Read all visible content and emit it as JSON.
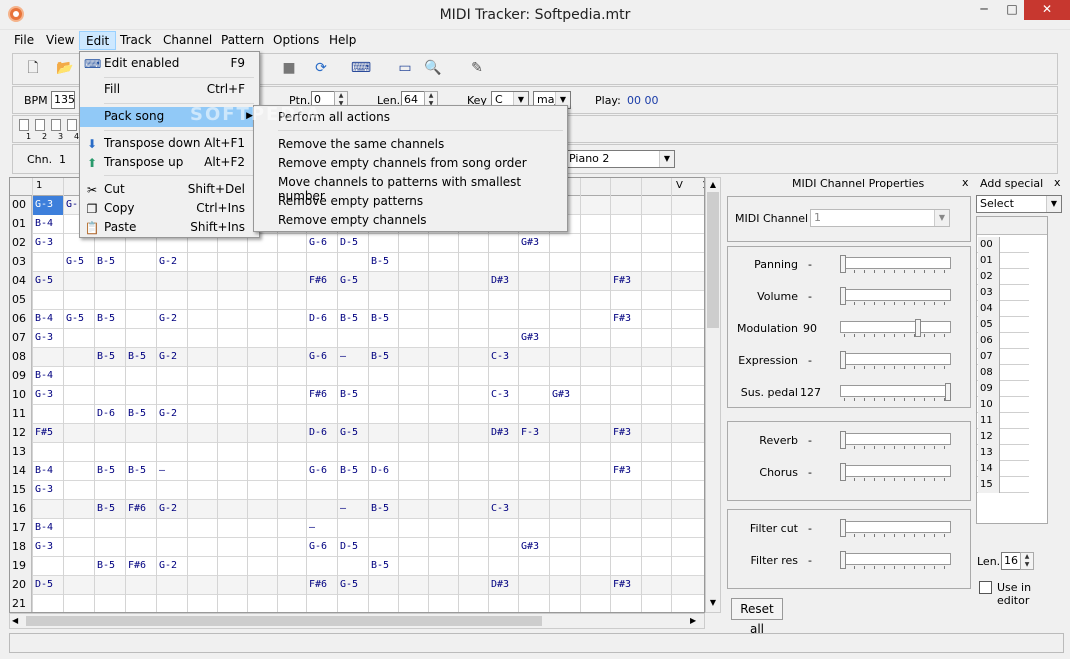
{
  "window": {
    "title": "MIDI Tracker: Softpedia.mtr",
    "min": "─",
    "max": "□",
    "close": "✕"
  },
  "menubar": [
    "File",
    "View",
    "Edit",
    "Track",
    "Channel",
    "Pattern",
    "Options",
    "Help"
  ],
  "toolbar": {
    "bpm_label": "BPM",
    "bpm_value": "135",
    "ptn_label": "Ptn.",
    "ptn_value": "0",
    "len_label": "Len.",
    "len_value": "64",
    "key_label": "Key",
    "key_value": "C",
    "scale_value": "maj",
    "play_label": "Play:",
    "play_value": "00 00"
  },
  "track_numbers": [
    "1",
    "2",
    "3",
    "4"
  ],
  "channel_row": {
    "label": "Chn.",
    "value": "1",
    "instrument": "Piano 2"
  },
  "grid": {
    "header_first": "1",
    "header_v": "V",
    "header_right": "1",
    "rows": [
      {
        "n": "00",
        "cells": [
          "G-3",
          "G-"
        ]
      },
      {
        "n": "01",
        "cells": [
          "B-4"
        ]
      },
      {
        "n": "02",
        "cells": [
          "G-3",
          "",
          "",
          "",
          "",
          "",
          "",
          "",
          "",
          "G-6",
          "D-5",
          "",
          "",
          "",
          "",
          "",
          "G#3"
        ]
      },
      {
        "n": "03",
        "cells": [
          "",
          "G-5",
          "B-5",
          "",
          "G-2",
          "",
          "",
          "",
          "",
          "",
          "",
          "B-5"
        ]
      },
      {
        "n": "04",
        "cells": [
          "G-5",
          "",
          "",
          "",
          "",
          "",
          "",
          "",
          "",
          "F#6",
          "G-5",
          "",
          "",
          "",
          "",
          "D#3",
          "",
          "",
          "",
          "F#3"
        ]
      },
      {
        "n": "05",
        "cells": []
      },
      {
        "n": "06",
        "cells": [
          "B-4",
          "G-5",
          "B-5",
          "",
          "G-2",
          "",
          "",
          "",
          "",
          "D-6",
          "B-5",
          "B-5",
          "",
          "",
          "",
          "",
          "",
          "",
          "",
          "F#3"
        ]
      },
      {
        "n": "07",
        "cells": [
          "G-3",
          "",
          "",
          "",
          "",
          "",
          "",
          "",
          "",
          "",
          "",
          "",
          "",
          "",
          "",
          "",
          "G#3"
        ]
      },
      {
        "n": "08",
        "cells": [
          "",
          "",
          "B-5",
          "B-5",
          "G-2",
          "",
          "",
          "",
          "",
          "G-6",
          "–",
          "B-5",
          "",
          "",
          "",
          "C-3"
        ]
      },
      {
        "n": "09",
        "cells": [
          "B-4"
        ]
      },
      {
        "n": "10",
        "cells": [
          "G-3",
          "",
          "",
          "",
          "",
          "",
          "",
          "",
          "",
          "F#6",
          "B-5",
          "",
          "",
          "",
          "",
          "C-3",
          "",
          "G#3"
        ]
      },
      {
        "n": "11",
        "cells": [
          "",
          "",
          "D-6",
          "B-5",
          "G-2"
        ]
      },
      {
        "n": "12",
        "cells": [
          "F#5",
          "",
          "",
          "",
          "",
          "",
          "",
          "",
          "",
          "D-6",
          "G-5",
          "",
          "",
          "",
          "",
          "D#3",
          "F-3",
          "",
          "",
          "F#3"
        ]
      },
      {
        "n": "13",
        "cells": []
      },
      {
        "n": "14",
        "cells": [
          "B-4",
          "",
          "B-5",
          "B-5",
          "–",
          "",
          "",
          "",
          "",
          "G-6",
          "B-5",
          "D-6",
          "",
          "",
          "",
          "",
          "",
          "",
          "",
          "F#3"
        ]
      },
      {
        "n": "15",
        "cells": [
          "G-3"
        ]
      },
      {
        "n": "16",
        "cells": [
          "",
          "",
          "B-5",
          "F#6",
          "G-2",
          "",
          "",
          "",
          "",
          "",
          "–",
          "B-5",
          "",
          "",
          "",
          "C-3"
        ]
      },
      {
        "n": "17",
        "cells": [
          "B-4",
          "",
          "",
          "",
          "",
          "",
          "",
          "",
          "",
          "–"
        ]
      },
      {
        "n": "18",
        "cells": [
          "G-3",
          "",
          "",
          "",
          "",
          "",
          "",
          "",
          "",
          "G-6",
          "D-5",
          "",
          "",
          "",
          "",
          "",
          "G#3"
        ]
      },
      {
        "n": "19",
        "cells": [
          "",
          "",
          "B-5",
          "F#6",
          "G-2",
          "",
          "",
          "",
          "",
          "",
          "",
          "B-5"
        ]
      },
      {
        "n": "20",
        "cells": [
          "D-5",
          "",
          "",
          "",
          "",
          "",
          "",
          "",
          "",
          "F#6",
          "G-5",
          "",
          "",
          "",
          "",
          "D#3",
          "",
          "",
          "",
          "F#3"
        ]
      },
      {
        "n": "21",
        "cells": []
      }
    ]
  },
  "edit_menu": [
    {
      "label": "Edit enabled",
      "key": "F9",
      "icon": "keyboard-icon"
    },
    {
      "label": "Fill",
      "key": "Ctrl+F"
    },
    {
      "label": "Pack song",
      "key": "▶"
    },
    {
      "label": "Transpose down",
      "key": "Alt+F1",
      "icon": "arrow-down-icon"
    },
    {
      "label": "Transpose up",
      "key": "Alt+F2",
      "icon": "arrow-up-icon"
    },
    {
      "label": "Cut",
      "key": "Shift+Del",
      "icon": "scissors-icon"
    },
    {
      "label": "Copy",
      "key": "Ctrl+Ins",
      "icon": "copy-icon"
    },
    {
      "label": "Paste",
      "key": "Shift+Ins",
      "icon": "paste-icon"
    }
  ],
  "pack_submenu": [
    "Perform all actions",
    "Remove the same channels",
    "Remove empty channels from song order",
    "Move channels to patterns with smallest number",
    "Remove empty patterns",
    "Remove empty channels"
  ],
  "props": {
    "title": "MIDI Channel Properties",
    "close": "x",
    "midi_channel_label": "MIDI Channel",
    "midi_channel_value": "1",
    "controls": [
      {
        "label": "Panning",
        "value": "-",
        "level": 0.0
      },
      {
        "label": "Volume",
        "value": "-",
        "level": 0.0
      },
      {
        "label": "Modulation",
        "value": "90",
        "level": 0.71
      },
      {
        "label": "Expression",
        "value": "-",
        "level": 0.0
      },
      {
        "label": "Sus. pedal",
        "value": "127",
        "level": 1.0
      },
      {
        "label": "Reverb",
        "value": "-",
        "level": 0.0
      },
      {
        "label": "Chorus",
        "value": "-",
        "level": 0.0
      },
      {
        "label": "Filter cut",
        "value": "-",
        "level": 0.0
      },
      {
        "label": "Filter res",
        "value": "-",
        "level": 0.0
      }
    ],
    "reset_label": "Reset all"
  },
  "add_special": {
    "title": "Add special",
    "close": "x",
    "select_value": "Select",
    "rows": [
      "00",
      "01",
      "02",
      "03",
      "04",
      "05",
      "06",
      "07",
      "08",
      "09",
      "10",
      "11",
      "12",
      "13",
      "14",
      "15"
    ],
    "len_label": "Len.",
    "len_value": "16",
    "use_in_editor": "Use in editor"
  },
  "watermark": "SOFTPEDIA"
}
